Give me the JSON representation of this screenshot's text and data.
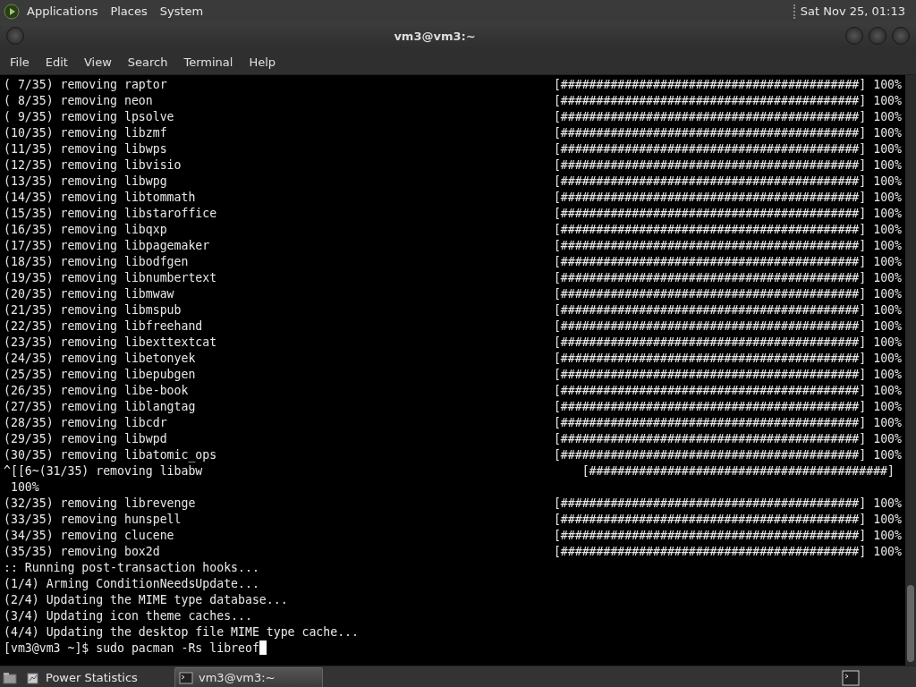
{
  "top_panel": {
    "menus": [
      {
        "label": "Applications"
      },
      {
        "label": "Places"
      },
      {
        "label": "System"
      }
    ],
    "clock": "Sat Nov 25, 01:13"
  },
  "window": {
    "title": "vm3@vm3:~"
  },
  "menu_bar": [
    {
      "label": "File"
    },
    {
      "label": "Edit"
    },
    {
      "label": "View"
    },
    {
      "label": "Search"
    },
    {
      "label": "Terminal"
    },
    {
      "label": "Help"
    }
  ],
  "terminal": {
    "lines": [
      {
        "text": "( 7/35) removing raptor",
        "bar": "[##########################################]",
        "percent": "100%"
      },
      {
        "text": "( 8/35) removing neon",
        "bar": "[##########################################]",
        "percent": "100%"
      },
      {
        "text": "( 9/35) removing lpsolve",
        "bar": "[##########################################]",
        "percent": "100%"
      },
      {
        "text": "(10/35) removing libzmf",
        "bar": "[##########################################]",
        "percent": "100%"
      },
      {
        "text": "(11/35) removing libwps",
        "bar": "[##########################################]",
        "percent": "100%"
      },
      {
        "text": "(12/35) removing libvisio",
        "bar": "[##########################################]",
        "percent": "100%"
      },
      {
        "text": "(13/35) removing libwpg",
        "bar": "[##########################################]",
        "percent": "100%"
      },
      {
        "text": "(14/35) removing libtommath",
        "bar": "[##########################################]",
        "percent": "100%"
      },
      {
        "text": "(15/35) removing libstaroffice",
        "bar": "[##########################################]",
        "percent": "100%"
      },
      {
        "text": "(16/35) removing libqxp",
        "bar": "[##########################################]",
        "percent": "100%"
      },
      {
        "text": "(17/35) removing libpagemaker",
        "bar": "[##########################################]",
        "percent": "100%"
      },
      {
        "text": "(18/35) removing libodfgen",
        "bar": "[##########################################]",
        "percent": "100%"
      },
      {
        "text": "(19/35) removing libnumbertext",
        "bar": "[##########################################]",
        "percent": "100%"
      },
      {
        "text": "(20/35) removing libmwaw",
        "bar": "[##########################################]",
        "percent": "100%"
      },
      {
        "text": "(21/35) removing libmspub",
        "bar": "[##########################################]",
        "percent": "100%"
      },
      {
        "text": "(22/35) removing libfreehand",
        "bar": "[##########################################]",
        "percent": "100%"
      },
      {
        "text": "(23/35) removing libexttextcat",
        "bar": "[##########################################]",
        "percent": "100%"
      },
      {
        "text": "(24/35) removing libetonyek",
        "bar": "[##########################################]",
        "percent": "100%"
      },
      {
        "text": "(25/35) removing libepubgen",
        "bar": "[##########################################]",
        "percent": "100%"
      },
      {
        "text": "(26/35) removing libe-book",
        "bar": "[##########################################]",
        "percent": "100%"
      },
      {
        "text": "(27/35) removing liblangtag",
        "bar": "[##########################################]",
        "percent": "100%"
      },
      {
        "text": "(28/35) removing libcdr",
        "bar": "[##########################################]",
        "percent": "100%"
      },
      {
        "text": "(29/35) removing libwpd",
        "bar": "[##########################################]",
        "percent": "100%"
      },
      {
        "text": "(30/35) removing libatomic_ops",
        "bar": "[##########################################]",
        "percent": "100%"
      },
      {
        "text": "^[[6~(31/35) removing libabw",
        "bar": "[##########################################]"
      },
      {
        "text": " 100%"
      },
      {
        "text": "(32/35) removing librevenge",
        "bar": "[##########################################]",
        "percent": "100%"
      },
      {
        "text": "(33/35) removing hunspell",
        "bar": "[##########################################]",
        "percent": "100%"
      },
      {
        "text": "(34/35) removing clucene",
        "bar": "[##########################################]",
        "percent": "100%"
      },
      {
        "text": "(35/35) removing box2d",
        "bar": "[##########################################]",
        "percent": "100%"
      },
      {
        "text": ":: Running post-transaction hooks..."
      },
      {
        "text": "(1/4) Arming ConditionNeedsUpdate..."
      },
      {
        "text": "(2/4) Updating the MIME type database..."
      },
      {
        "text": "(3/4) Updating icon theme caches..."
      },
      {
        "text": "(4/4) Updating the desktop file MIME type cache..."
      }
    ],
    "prompt": "[vm3@vm3 ~]$ sudo pacman -Rs libreof"
  },
  "taskbar": {
    "items": [
      {
        "label": "Power Statistics",
        "selected": false
      },
      {
        "label": "vm3@vm3:~",
        "selected": true
      }
    ]
  }
}
